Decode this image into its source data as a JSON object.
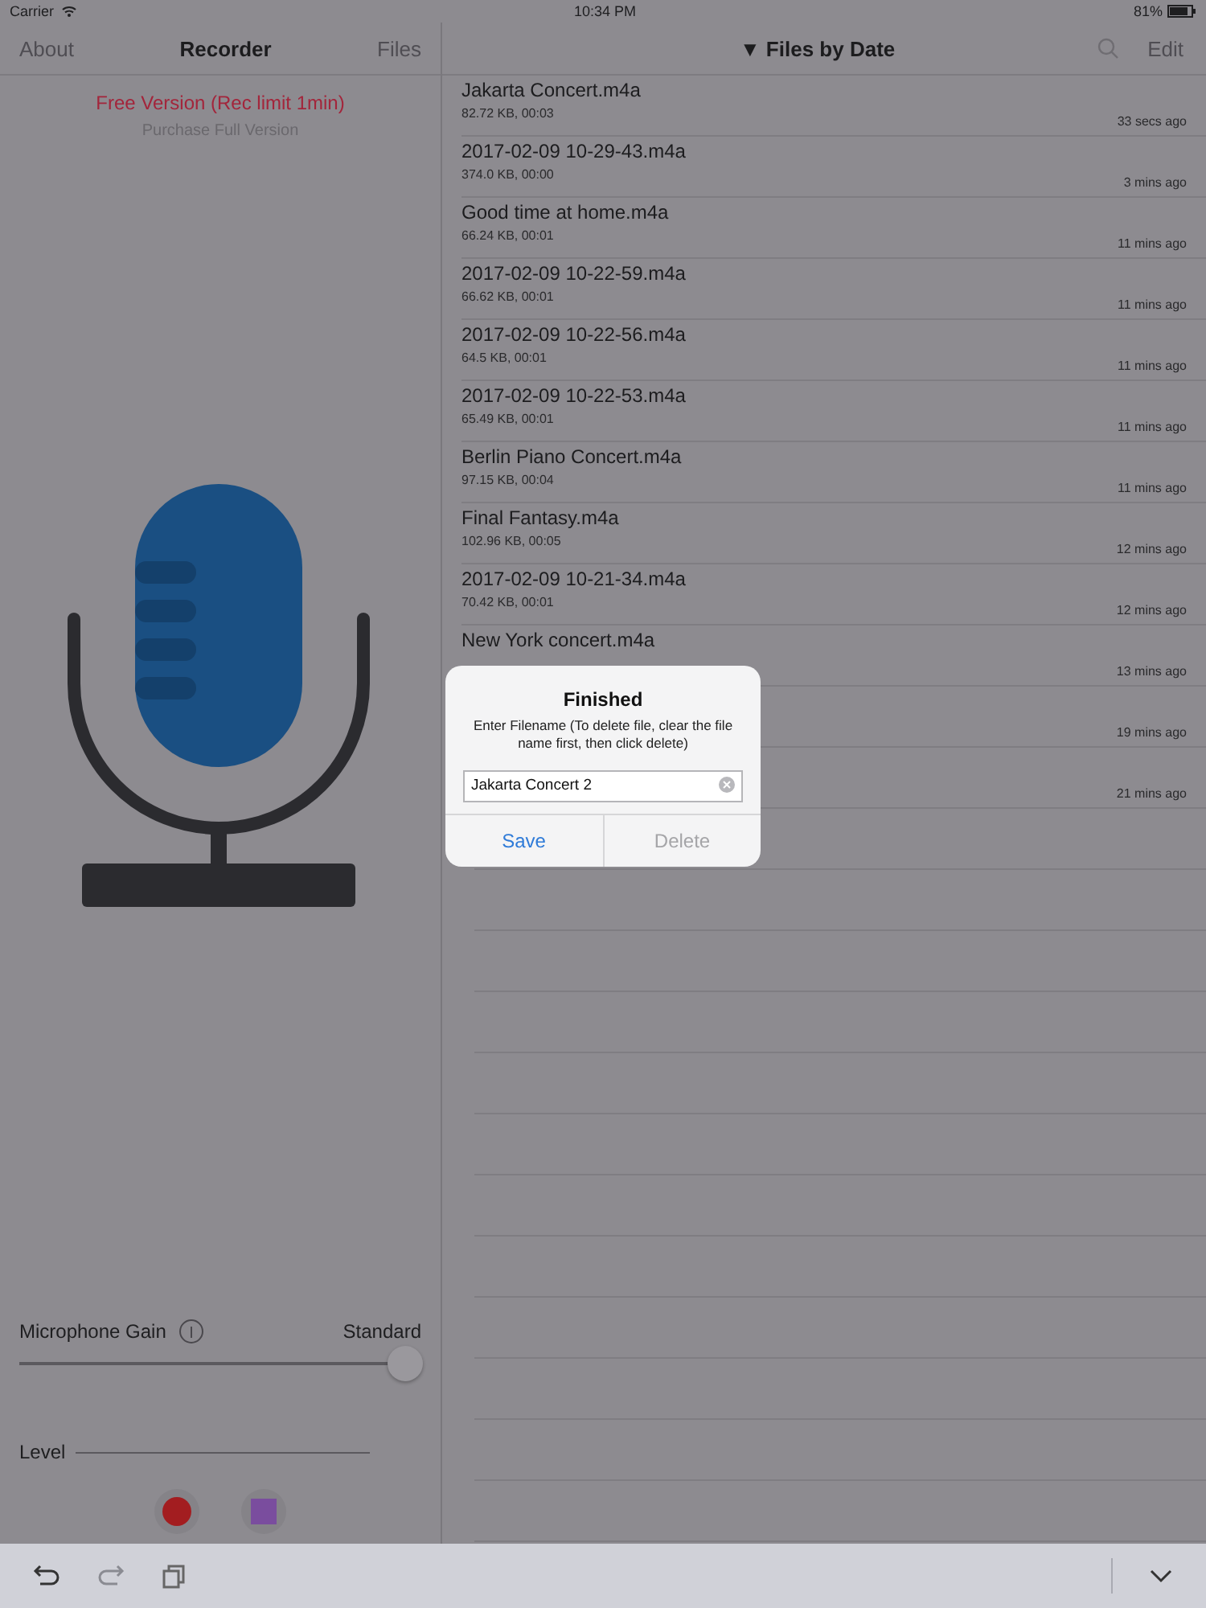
{
  "status_bar": {
    "carrier": "Carrier",
    "time": "10:34 PM",
    "battery": "81%"
  },
  "left_nav": {
    "left": "About",
    "title": "Recorder",
    "right": "Files"
  },
  "promo": {
    "title": "Free Version (Rec limit 1min)",
    "link": "Purchase Full Version"
  },
  "gain": {
    "label": "Microphone Gain",
    "value": "Standard",
    "level": 1.0
  },
  "level_meter": {
    "label": "Level"
  },
  "right_nav": {
    "title": "▼ Files by Date",
    "right": "Edit"
  },
  "files": [
    {
      "name": "Jakarta Concert.m4a",
      "size": "82.72 KB, 00:03",
      "time": "33 secs ago"
    },
    {
      "name": "2017-02-09 10-29-43.m4a",
      "size": "374.0 KB, 00:00",
      "time": "3 mins ago"
    },
    {
      "name": "Good time at home.m4a",
      "size": "66.24 KB, 00:01",
      "time": "11 mins ago"
    },
    {
      "name": "2017-02-09 10-22-59.m4a",
      "size": "66.62 KB, 00:01",
      "time": "11 mins ago"
    },
    {
      "name": "2017-02-09 10-22-56.m4a",
      "size": "64.5 KB, 00:01",
      "time": "11 mins ago"
    },
    {
      "name": "2017-02-09 10-22-53.m4a",
      "size": "65.49 KB, 00:01",
      "time": "11 mins ago"
    },
    {
      "name": "Berlin Piano Concert.m4a",
      "size": "97.15 KB, 00:04",
      "time": "11 mins ago"
    },
    {
      "name": "Final Fantasy.m4a",
      "size": "102.96 KB, 00:05",
      "time": "12 mins ago"
    },
    {
      "name": "2017-02-09 10-21-34.m4a",
      "size": "70.42 KB, 00:01",
      "time": "12 mins ago"
    },
    {
      "name": "New York concert.m4a",
      "time": "13 mins ago"
    },
    {
      "time": "19 mins ago"
    },
    {
      "time": "21 mins ago"
    }
  ],
  "dialog": {
    "title": "Finished",
    "message": "Enter Filename (To delete file, clear the file name first, then click delete)",
    "value": "Jakarta Concert 2",
    "buttons": [
      {
        "label": "Save",
        "disabled": false
      },
      {
        "label": "Delete",
        "disabled": true
      }
    ]
  }
}
